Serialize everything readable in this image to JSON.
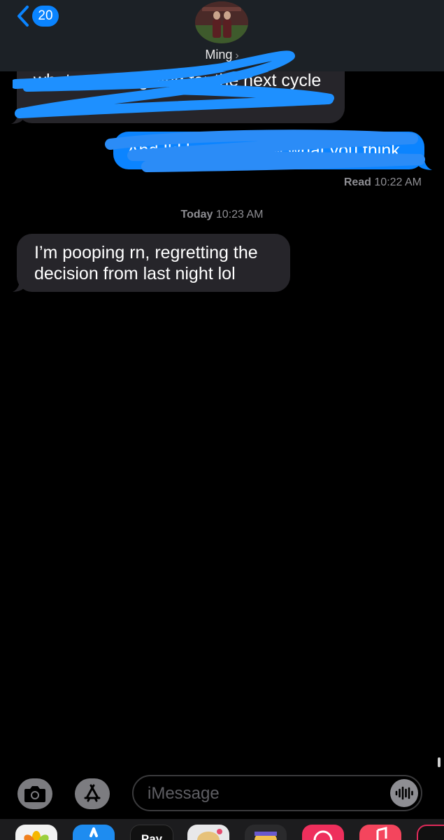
{
  "header": {
    "back_badge": "20",
    "contact_name": "Ming",
    "name_chevron": "›"
  },
  "messages": [
    {
      "direction": "incoming",
      "text": "what you are giving for the next cycle",
      "redacted": true
    },
    {
      "direction": "outgoing",
      "text": "And I'd love to know what you think",
      "redacted": true
    },
    {
      "direction": "incoming",
      "text_line1": "I’m pooping rn, regretting the",
      "text_line2": "decision from last night lol"
    }
  ],
  "receipt": {
    "status": "Read",
    "time": "10:22 AM"
  },
  "timestamp": {
    "day": "Today",
    "time": "10:23 AM"
  },
  "input": {
    "placeholder": "iMessage"
  },
  "app_drawer": {
    "apple_pay_label": " Pay"
  },
  "colors": {
    "accent": "#0a84ff",
    "incoming_bubble": "#26252a",
    "outgoing_bubble": "#0b84ff",
    "scribble": "#1e90ff"
  }
}
